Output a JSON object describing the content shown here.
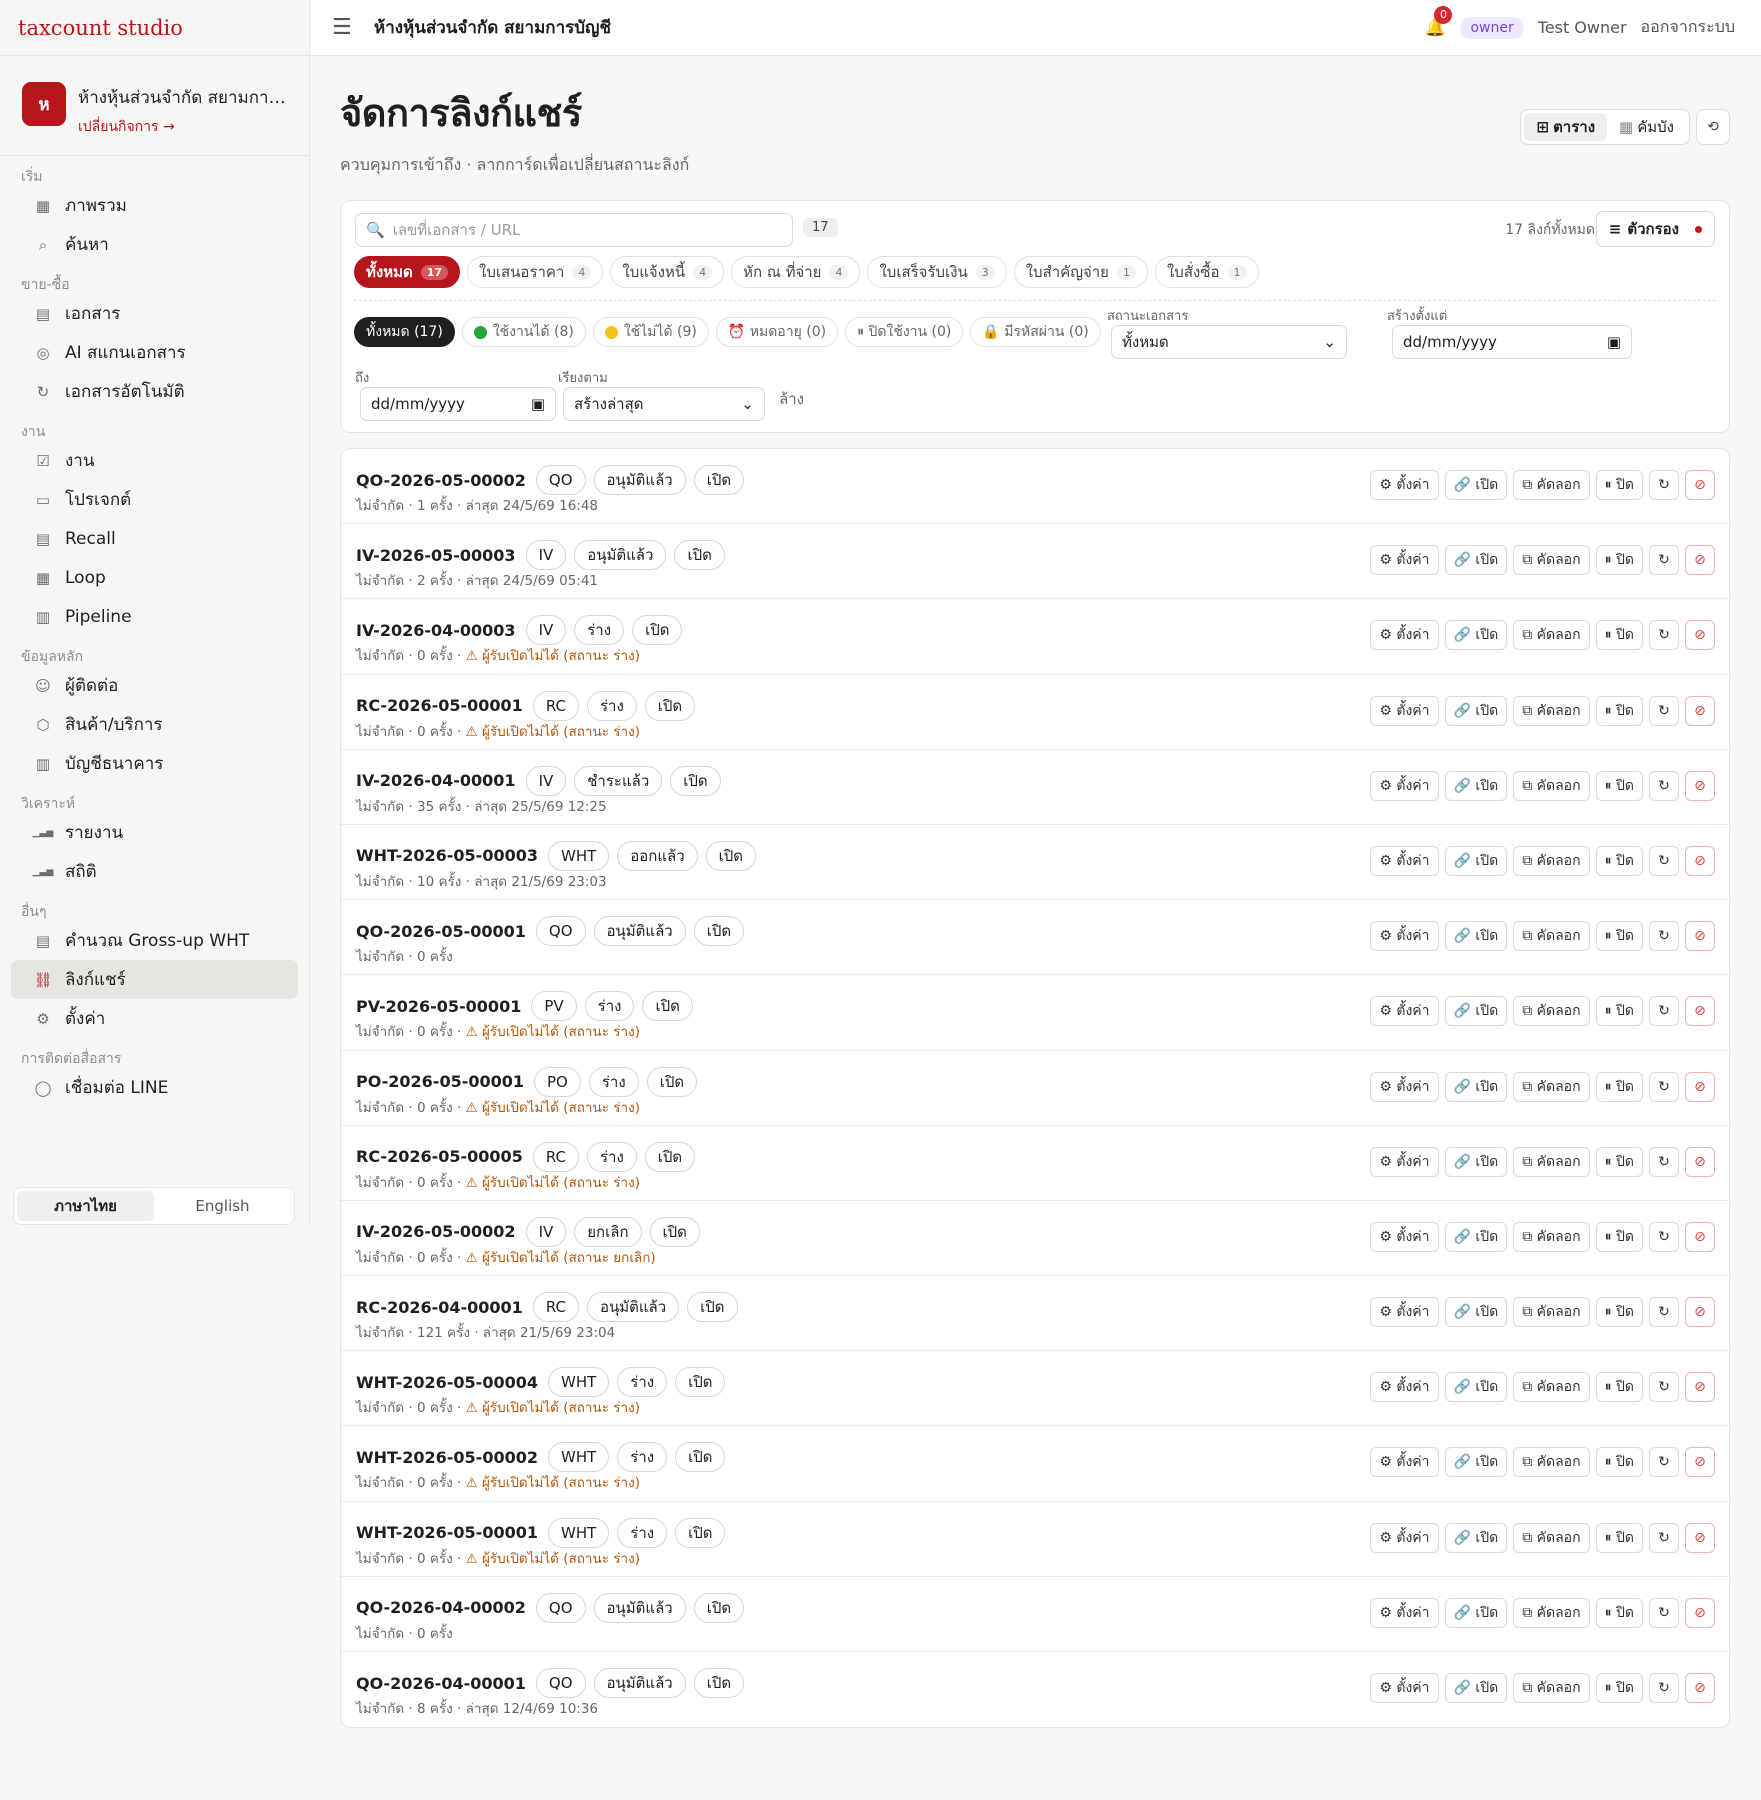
{
  "brand": "taxcount studio",
  "business": {
    "initial": "ห",
    "name": "ห้างหุ้นส่วนจำกัด สยามการ...",
    "switch": "เปลี่ยนกิจการ →"
  },
  "topbar": {
    "title": "ห้างหุ้นส่วนจำกัด สยามการบัญชี",
    "notif": "0",
    "role": "owner",
    "user": "Test Owner",
    "logout": "ออกจากระบบ"
  },
  "nav": [
    {
      "section": "เริ่ม",
      "items": [
        {
          "label": "ภาพรวม",
          "icon": "grid-icon",
          "glyph": "▦"
        },
        {
          "label": "ค้นหา",
          "icon": "search-icon",
          "glyph": "⌕"
        }
      ]
    },
    {
      "section": "ขาย-ซื้อ",
      "items": [
        {
          "label": "เอกสาร",
          "icon": "document-icon",
          "glyph": "▤"
        },
        {
          "label": "AI สแกนเอกสาร",
          "icon": "camera-icon",
          "glyph": "◎"
        },
        {
          "label": "เอกสารอัตโนมัติ",
          "icon": "refresh-icon",
          "glyph": "↻"
        }
      ]
    },
    {
      "section": "งาน",
      "items": [
        {
          "label": "งาน",
          "icon": "check-square-icon",
          "glyph": "☑"
        },
        {
          "label": "โปรเจกต์",
          "icon": "folder-icon",
          "glyph": "▭"
        },
        {
          "label": "Recall",
          "icon": "clipboard-icon",
          "glyph": "▤"
        },
        {
          "label": "Loop",
          "icon": "calendar-icon",
          "glyph": "▦"
        },
        {
          "label": "Pipeline",
          "icon": "kanban-icon",
          "glyph": "▥"
        }
      ]
    },
    {
      "section": "ข้อมูลหลัก",
      "items": [
        {
          "label": "ผู้ติดต่อ",
          "icon": "users-icon",
          "glyph": "☺"
        },
        {
          "label": "สินค้า/บริการ",
          "icon": "box-icon",
          "glyph": "⬡"
        },
        {
          "label": "บัญชีธนาคาร",
          "icon": "bank-icon",
          "glyph": "▥"
        }
      ]
    },
    {
      "section": "วิเคราะห์",
      "items": [
        {
          "label": "รายงาน",
          "icon": "bar-chart-icon",
          "glyph": "▁▃▅"
        },
        {
          "label": "สถิติ",
          "icon": "bar-chart-icon",
          "glyph": "▁▃▅"
        }
      ]
    },
    {
      "section": "อื่นๆ",
      "items": [
        {
          "label": "คำนวณ Gross-up WHT",
          "icon": "calculator-icon",
          "glyph": "▤"
        },
        {
          "label": "ลิงก์แชร์",
          "icon": "link-icon",
          "glyph": "⛓",
          "active": true
        },
        {
          "label": "ตั้งค่า",
          "icon": "gear-icon",
          "glyph": "⚙"
        }
      ]
    },
    {
      "section": "การติดต่อสื่อสาร",
      "items": [
        {
          "label": "เชื่อมต่อ LINE",
          "icon": "chat-icon",
          "glyph": "◯"
        }
      ]
    }
  ],
  "lang": {
    "th": "ภาษาไทย",
    "en": "English"
  },
  "page": {
    "title": "จัดการลิงก์แชร์",
    "subtitle": "ควบคุมการเข้าถึง · ลากการ์ดเพื่อเปลี่ยนสถานะลิงก์",
    "view_table": "ตาราง",
    "view_board": "คัมบัง",
    "refresh": "⟲"
  },
  "filters": {
    "search_placeholder": "เลขที่เอกสาร / URL",
    "count": "17",
    "total": "17 ลิงก์ทั้งหมด",
    "filter_btn": "ตัวกรอง",
    "types": [
      {
        "label": "ทั้งหมด",
        "n": "17",
        "on": true
      },
      {
        "label": "ใบเสนอราคา",
        "n": "4"
      },
      {
        "label": "ใบแจ้งหนี้",
        "n": "4"
      },
      {
        "label": "หัก ณ ที่จ่าย",
        "n": "4"
      },
      {
        "label": "ใบเสร็จรับเงิน",
        "n": "3"
      },
      {
        "label": "ใบสำคัญจ่าย",
        "n": "1"
      },
      {
        "label": "ใบสั่งซื้อ",
        "n": "1"
      }
    ],
    "stats": [
      {
        "label": "ทั้งหมด (17)",
        "on": true
      },
      {
        "label": "ใช้งานได้ (8)",
        "dot": "#22a63a"
      },
      {
        "label": "ใช้ไม่ได้ (9)",
        "dot": "#f2c21b"
      },
      {
        "label": "⏰ หมดอายุ (0)"
      },
      {
        "label": "⏸ ปิดใช้งาน (0)"
      },
      {
        "label": "🔒 มีรหัสผ่าน (0)"
      }
    ],
    "doc_status_label": "สถานะเอกสาร",
    "doc_status_value": "ทั้งหมด",
    "created_from_label": "สร้างตั้งแต่",
    "created_from_value": "dd/mm/yyyy",
    "to_label": "ถึง",
    "to_value": "dd/mm/yyyy",
    "sort_label": "เรียงตาม",
    "sort_value": "สร้างล่าสุด",
    "clear": "ล้าง"
  },
  "actions": {
    "settings": "⚙ ตั้งค่า",
    "open": "🔗 เปิด",
    "copy": "⧉ คัดลอก",
    "close": "⏸ ปิด",
    "regen": "↻",
    "revoke": "⊘"
  },
  "links": [
    {
      "doc": "QO-2026-05-00002",
      "type": "QO",
      "status": "อนุมัติแล้ว",
      "state": "เปิด",
      "meta": "ไม่จำกัด · 1 ครั้ง · ล่าสุด 24/5/69 16:48",
      "warn": ""
    },
    {
      "doc": "IV-2026-05-00003",
      "type": "IV",
      "status": "อนุมัติแล้ว",
      "state": "เปิด",
      "meta": "ไม่จำกัด · 2 ครั้ง · ล่าสุด 24/5/69 05:41",
      "warn": ""
    },
    {
      "doc": "IV-2026-04-00003",
      "type": "IV",
      "status": "ร่าง",
      "state": "เปิด",
      "meta": "ไม่จำกัด · 0 ครั้ง · ",
      "warn": "⚠ ผู้รับเปิดไม่ได้ (สถานะ ร่าง)"
    },
    {
      "doc": "RC-2026-05-00001",
      "type": "RC",
      "status": "ร่าง",
      "state": "เปิด",
      "meta": "ไม่จำกัด · 0 ครั้ง · ",
      "warn": "⚠ ผู้รับเปิดไม่ได้ (สถานะ ร่าง)"
    },
    {
      "doc": "IV-2026-04-00001",
      "type": "IV",
      "status": "ชำระแล้ว",
      "state": "เปิด",
      "meta": "ไม่จำกัด · 35 ครั้ง · ล่าสุด 25/5/69 12:25",
      "warn": ""
    },
    {
      "doc": "WHT-2026-05-00003",
      "type": "WHT",
      "status": "ออกแล้ว",
      "state": "เปิด",
      "meta": "ไม่จำกัด · 10 ครั้ง · ล่าสุด 21/5/69 23:03",
      "warn": ""
    },
    {
      "doc": "QO-2026-05-00001",
      "type": "QO",
      "status": "อนุมัติแล้ว",
      "state": "เปิด",
      "meta": "ไม่จำกัด · 0 ครั้ง",
      "warn": ""
    },
    {
      "doc": "PV-2026-05-00001",
      "type": "PV",
      "status": "ร่าง",
      "state": "เปิด",
      "meta": "ไม่จำกัด · 0 ครั้ง · ",
      "warn": "⚠ ผู้รับเปิดไม่ได้ (สถานะ ร่าง)"
    },
    {
      "doc": "PO-2026-05-00001",
      "type": "PO",
      "status": "ร่าง",
      "state": "เปิด",
      "meta": "ไม่จำกัด · 0 ครั้ง · ",
      "warn": "⚠ ผู้รับเปิดไม่ได้ (สถานะ ร่าง)"
    },
    {
      "doc": "RC-2026-05-00005",
      "type": "RC",
      "status": "ร่าง",
      "state": "เปิด",
      "meta": "ไม่จำกัด · 0 ครั้ง · ",
      "warn": "⚠ ผู้รับเปิดไม่ได้ (สถานะ ร่าง)"
    },
    {
      "doc": "IV-2026-05-00002",
      "type": "IV",
      "status": "ยกเลิก",
      "state": "เปิด",
      "meta": "ไม่จำกัด · 0 ครั้ง · ",
      "warn": "⚠ ผู้รับเปิดไม่ได้ (สถานะ ยกเลิก)"
    },
    {
      "doc": "RC-2026-04-00001",
      "type": "RC",
      "status": "อนุมัติแล้ว",
      "state": "เปิด",
      "meta": "ไม่จำกัด · 121 ครั้ง · ล่าสุด 21/5/69 23:04",
      "warn": ""
    },
    {
      "doc": "WHT-2026-05-00004",
      "type": "WHT",
      "status": "ร่าง",
      "state": "เปิด",
      "meta": "ไม่จำกัด · 0 ครั้ง · ",
      "warn": "⚠ ผู้รับเปิดไม่ได้ (สถานะ ร่าง)"
    },
    {
      "doc": "WHT-2026-05-00002",
      "type": "WHT",
      "status": "ร่าง",
      "state": "เปิด",
      "meta": "ไม่จำกัด · 0 ครั้ง · ",
      "warn": "⚠ ผู้รับเปิดไม่ได้ (สถานะ ร่าง)"
    },
    {
      "doc": "WHT-2026-05-00001",
      "type": "WHT",
      "status": "ร่าง",
      "state": "เปิด",
      "meta": "ไม่จำกัด · 0 ครั้ง · ",
      "warn": "⚠ ผู้รับเปิดไม่ได้ (สถานะ ร่าง)"
    },
    {
      "doc": "QO-2026-04-00002",
      "type": "QO",
      "status": "อนุมัติแล้ว",
      "state": "เปิด",
      "meta": "ไม่จำกัด · 0 ครั้ง",
      "warn": ""
    },
    {
      "doc": "QO-2026-04-00001",
      "type": "QO",
      "status": "อนุมัติแล้ว",
      "state": "เปิด",
      "meta": "ไม่จำกัด · 8 ครั้ง · ล่าสุด 12/4/69 10:36",
      "warn": ""
    }
  ]
}
